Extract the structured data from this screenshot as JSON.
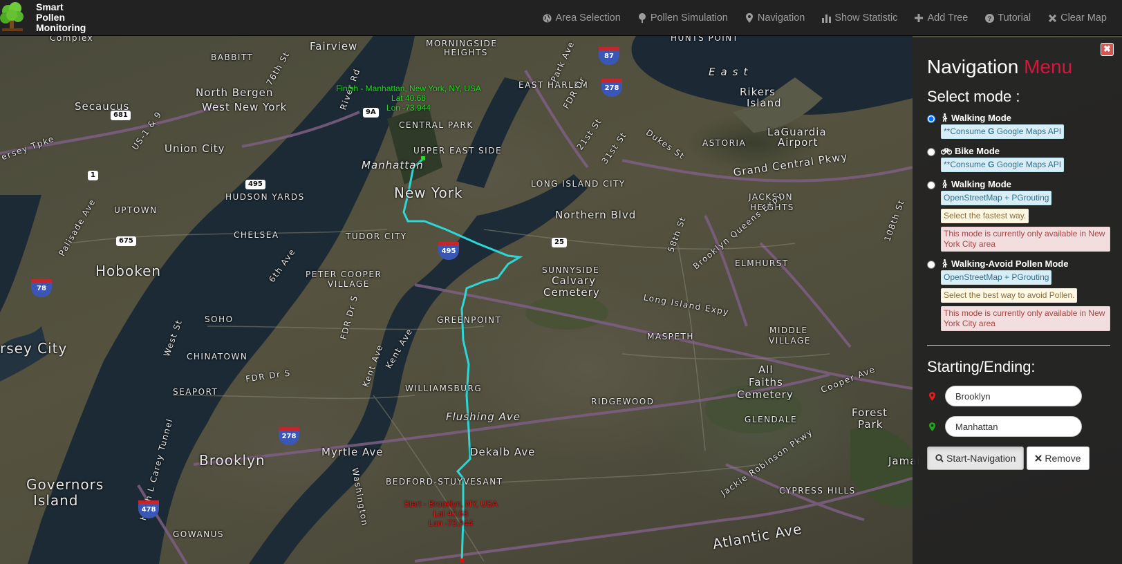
{
  "brand": {
    "line1": "Smart",
    "line2": "Pollen",
    "line3": "Monitoring"
  },
  "nav": {
    "items": [
      {
        "label": "Area Selection",
        "icon": "globe-icon"
      },
      {
        "label": "Pollen Simulation",
        "icon": "tree-icon"
      },
      {
        "label": "Navigation",
        "icon": "map-marker-icon"
      },
      {
        "label": "Show Statistic",
        "icon": "bar-chart-icon"
      },
      {
        "label": "Add Tree",
        "icon": "plus-icon"
      },
      {
        "label": "Tutorial",
        "icon": "question-circle-icon"
      },
      {
        "label": "Clear Map",
        "icon": "close-icon"
      }
    ]
  },
  "map": {
    "labels": {
      "fairview": "Fairview",
      "morningside": "MORNINGSIDE",
      "heights": "HEIGHTS",
      "north_bergen": "North Bergen",
      "west_new_york": "West New York",
      "secaucus": "Secaucus",
      "union_city": "Union City",
      "east_harlem": "EAST HARLEM",
      "east": "East",
      "rikers": "Rikers",
      "island": "Island",
      "laguardia": "LaGuardia",
      "airport": "Airport",
      "astoria": "ASTORIA",
      "upper_east_side": "UPPER EAST SIDE",
      "manhattan": "Manhattan",
      "new_york": "New York",
      "hudson_yards": "HUDSON YARDS",
      "long_island_city": "LONG ISLAND CITY",
      "jackson": "JACKSON",
      "jackson_heights": "HEIGHTS",
      "uptown": "UPTOWN",
      "northern_blvd": "Northern Blvd",
      "chelsea": "CHELSEA",
      "tudor_city": "TUDOR CITY",
      "hoboken": "Hoboken",
      "sunnyside": "SUNNYSIDE",
      "elmhurst": "ELMHURST",
      "peter_cooper": "PETER COOPER",
      "village_pc": "VILLAGE",
      "calvary": "Calvary",
      "cemetery": "Cemetery",
      "soho": "SOHO",
      "greenpoint": "GREENPOINT",
      "middle": "MIDDLE",
      "middle_village": "VILLAGE",
      "maspeth": "MASPETH",
      "jersey_city": "rsey City",
      "chinatown": "CHINATOWN",
      "all": "All",
      "faiths": "Faiths",
      "all_cemetery": "Cemetery",
      "williamsburg": "WILLIAMSBURG",
      "seaport": "SEAPORT",
      "ridgewood": "RIDGEWOOD",
      "flushing": "Flushing Ave",
      "forest": "Forest",
      "park": "Park",
      "glendale": "GLENDALE",
      "brooklyn": "Brooklyn",
      "myrtle": "Myrtle Ave",
      "dekalb": "Dekalb Ave",
      "governors": "Governors",
      "gov_island": "Island",
      "bedford": "BEDFORD-STUYVESANT",
      "cypress": "CYPRESS HILLS",
      "gowanus": "GOWANUS",
      "atlantic": "Atlantic Ave",
      "grand_central": "Grand Central Pkwy",
      "long_island_expy": "Long Island Expy",
      "fdr": "FDR Dr S",
      "bqe": "Brooklyn Queens Expy",
      "jackie": "Jackie Robinson Pkwy",
      "cooper_ave": "Cooper Ave",
      "jamaica": "Jamai",
      "dutton": "Dukes St",
      "st21": "21st St",
      "st31": "31st St",
      "st58": "58th St",
      "st108": "108th St",
      "ave6": "6th Ave",
      "ave8": "Palisade Ave",
      "west_st": "West St",
      "kent": "Kent Ave",
      "kent2": "Kent Ave",
      "washington": "Washington",
      "river_rd": "River Rd",
      "park_ave": "Park Ave",
      "hunts_point": "HUNTS POINT",
      "complex": "Complex",
      "babbitt": "BABBITT",
      "ave76": "76th St",
      "central_park": "CENTRAL PARK",
      "jersey_tpke": "ersey Tpke",
      "us1": "US-1 & 9",
      "fdr_dr": "FDR Dr",
      "hugh": "Hugh L Carey Tunnel",
      "fdr2": "FDR Dr S"
    },
    "shields": {
      "s681": "681",
      "s9a": "9A",
      "s87": "87",
      "s278a": "278",
      "s1": "1",
      "s495": "495",
      "s675": "675",
      "s25": "25",
      "s495i": "495",
      "s78": "78",
      "s278b": "278",
      "s478": "478"
    },
    "finish": {
      "title": "Finish - Manhattan, New York, NY, USA",
      "lat": "Lat 40.68",
      "lon": "Lon -73.944"
    },
    "start": {
      "title": "Start - Brooklyn, NY, USA",
      "lat": "Lat 40.68",
      "lon": "Lon -73.944"
    },
    "colors": {
      "route": "#2fd6d6",
      "finish": "#22dd22",
      "start": "#dd1111"
    }
  },
  "panel": {
    "title_main": "Navigation",
    "title_accent": "Menu",
    "select_mode": "Select mode :",
    "modes": [
      {
        "label": "Walking Mode",
        "icon": "walking-icon",
        "selected": true,
        "tags": [
          {
            "type": "info",
            "text": "**Consume",
            "g": "G",
            "rest": "Google Maps API"
          }
        ]
      },
      {
        "label": "Bike Mode",
        "icon": "bicycle-icon",
        "selected": false,
        "tags": [
          {
            "type": "info",
            "text": "**Consume",
            "g": "G",
            "rest": "Google Maps API"
          }
        ]
      },
      {
        "label": "Walking Mode",
        "icon": "walking-icon",
        "selected": false,
        "tags": [
          {
            "type": "info",
            "text": "OpenStreetMap + PGrouting"
          },
          {
            "type": "warn",
            "text": "Select the fastest way."
          },
          {
            "type": "danger",
            "text": "This mode is currently only available in New York City area"
          }
        ]
      },
      {
        "label": "Walking-Avoid Pollen Mode",
        "icon": "walking-icon",
        "selected": false,
        "tags": [
          {
            "type": "info",
            "text": "OpenStreetMap + PGrouting"
          },
          {
            "type": "warn",
            "text": "Select the best way to avoid Pollen."
          },
          {
            "type": "danger",
            "text": "This mode is currently only available in New York City area"
          }
        ]
      }
    ],
    "starting_ending": "Starting/Ending:",
    "start_value": "Brooklyn",
    "end_value": "Manhattan",
    "start_button": "Start-Navigation",
    "remove_button": "Remove",
    "close": "✖"
  }
}
